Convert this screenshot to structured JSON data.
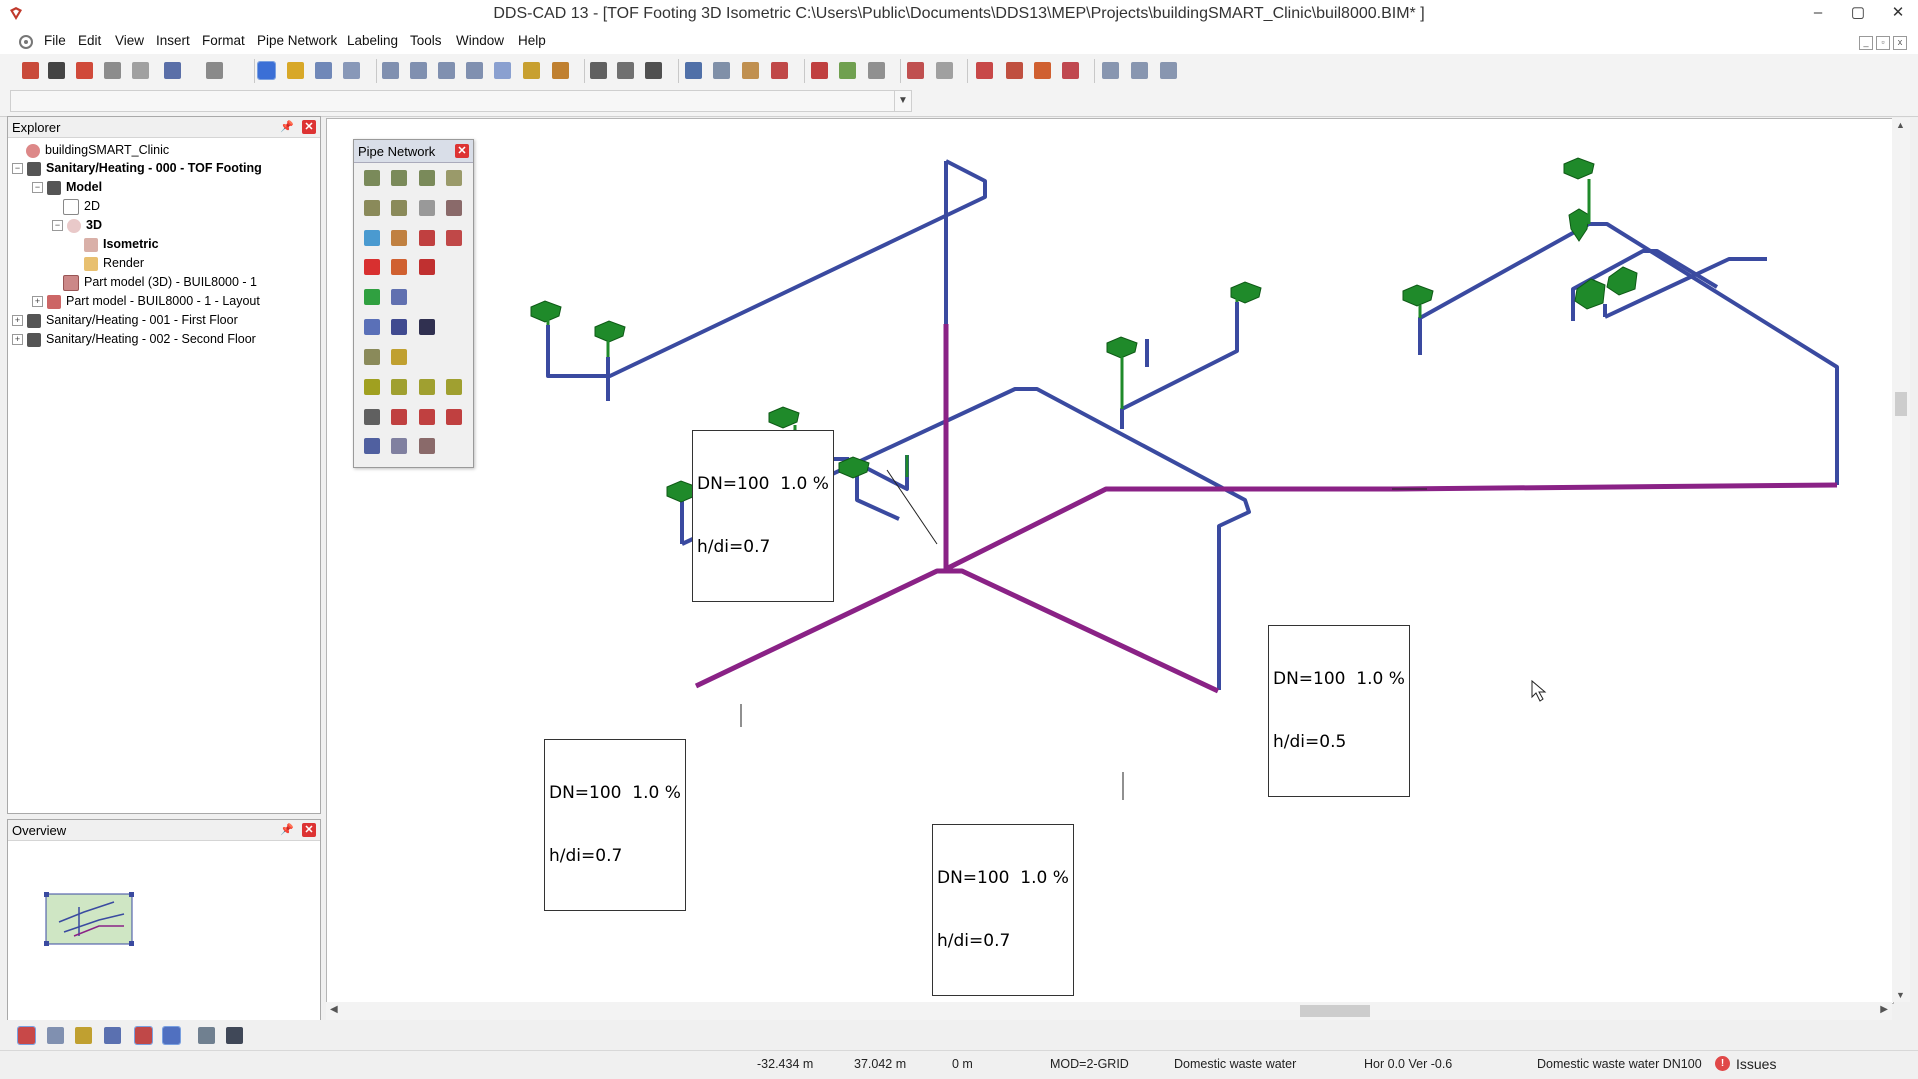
{
  "window": {
    "title": "DDS-CAD 13 - [TOF Footing  3D  Isometric  C:\\Users\\Public\\Documents\\DDS13\\MEP\\Projects\\buildingSMART_Clinic\\buil8000.BIM* ]",
    "minimize": "–",
    "maximize": "▢",
    "close": "✕"
  },
  "menu": [
    "File",
    "Edit",
    "View",
    "Insert",
    "Format",
    "Pipe Network",
    "Labeling",
    "Tools",
    "Window",
    "Help"
  ],
  "explorer": {
    "title": "Explorer",
    "pin": "ᵖ",
    "close": "✕",
    "tree": [
      {
        "label": "buildingSMART_Clinic",
        "bold": false
      },
      {
        "label": "Sanitary/Heating - 000 - TOF Footing",
        "bold": true
      },
      {
        "label": "Model",
        "bold": true
      },
      {
        "label": "2D",
        "bold": false
      },
      {
        "label": "3D",
        "bold": true
      },
      {
        "label": "Isometric",
        "bold": true
      },
      {
        "label": "Render",
        "bold": false
      },
      {
        "label": "Part model (3D) - BUIL8000 - 1",
        "bold": false
      },
      {
        "label": "Part model - BUIL8000 - 1 - Layout",
        "bold": false
      },
      {
        "label": "Sanitary/Heating - 001 - First Floor",
        "bold": false
      },
      {
        "label": "Sanitary/Heating - 002 - Second Floor",
        "bold": false
      }
    ]
  },
  "overview": {
    "title": "Overview",
    "close": "✕"
  },
  "pipe_network_palette": {
    "title": "Pipe Network",
    "close": "✕"
  },
  "labels": [
    {
      "line1": "DN=100  1.0 %",
      "line2": "h/di=0.7"
    },
    {
      "line1": "DN=100  1.0 %",
      "line2": "h/di=0.5"
    },
    {
      "line1": "DN=100  1.0 %",
      "line2": "h/di=0.7"
    },
    {
      "line1": "DN=100  1.0 %",
      "line2": "h/di=0.7"
    }
  ],
  "colors": {
    "pipe_blue": "#3a4aa0",
    "pipe_purple": "#8a2286",
    "fixture_green": "#1f8a2a"
  },
  "status": {
    "x": "-32.434 m",
    "y": "37.042 m",
    "z": "0 m",
    "mod": "MOD=2-GRID",
    "system": "Domestic waste water",
    "angles": "Hor  0.0 Ver  -0.6",
    "pipe": "Domestic waste water DN100",
    "issues": "Issues",
    "issues_icon": "!"
  }
}
